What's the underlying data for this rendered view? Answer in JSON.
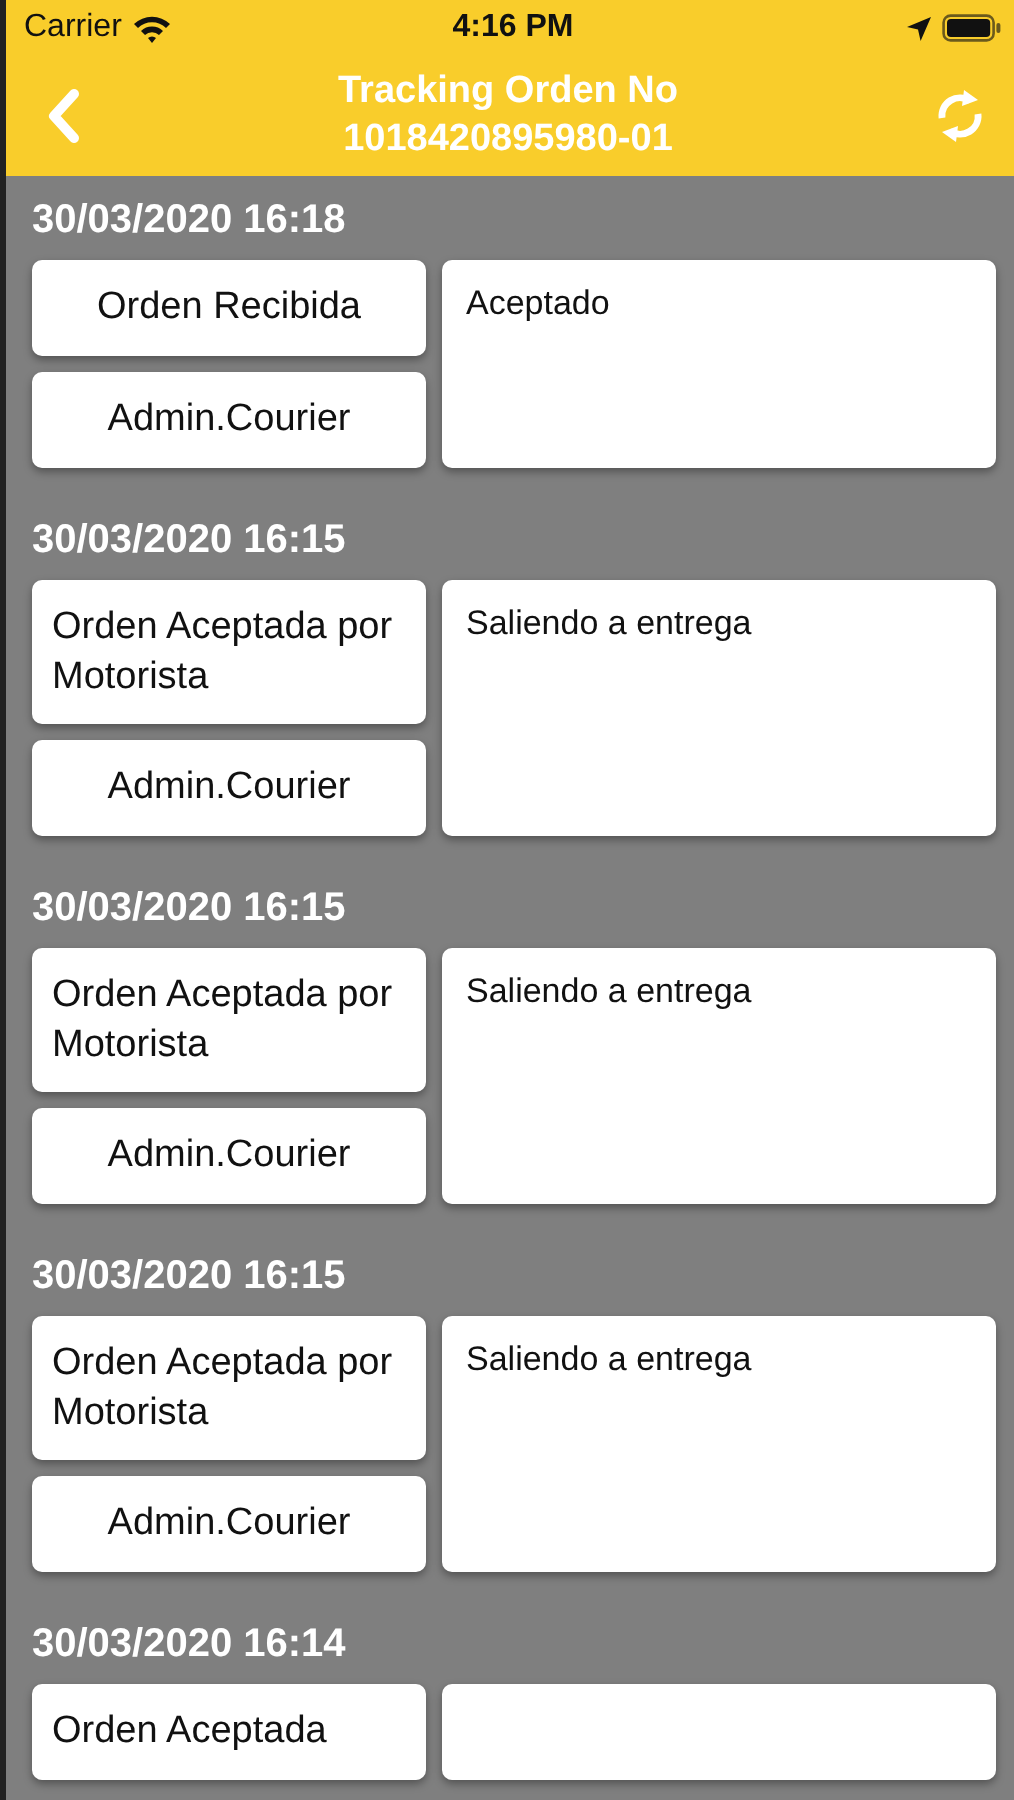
{
  "status_bar": {
    "carrier": "Carrier",
    "time": "4:16 PM"
  },
  "nav": {
    "title": "Tracking Orden No",
    "order_number": "1018420895980-01"
  },
  "entries": [
    {
      "datetime": "30/03/2020 16:18",
      "status": "Orden Recibida",
      "user": "Admin.Courier",
      "note": "Aceptado"
    },
    {
      "datetime": "30/03/2020 16:15",
      "status": "Orden Aceptada por Motorista",
      "user": "Admin.Courier",
      "note": "Saliendo a entrega"
    },
    {
      "datetime": "30/03/2020 16:15",
      "status": "Orden Aceptada por Motorista",
      "user": "Admin.Courier",
      "note": "Saliendo a entrega"
    },
    {
      "datetime": "30/03/2020 16:15",
      "status": "Orden Aceptada por Motorista",
      "user": "Admin.Courier",
      "note": "Saliendo a entrega"
    },
    {
      "datetime": "30/03/2020 16:14",
      "status": "Orden Aceptada"
    }
  ]
}
